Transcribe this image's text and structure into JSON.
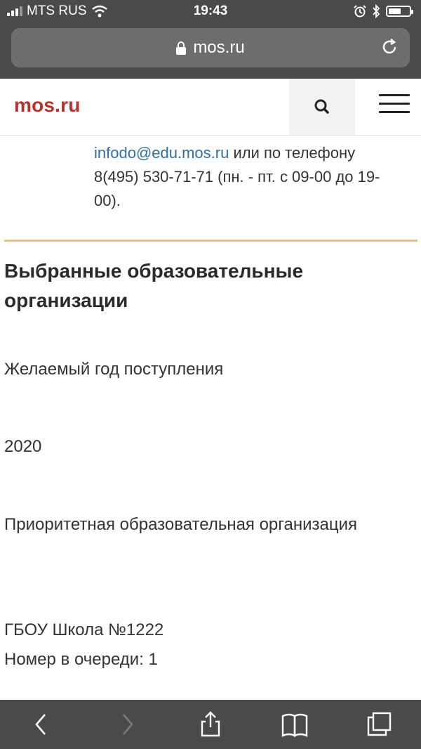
{
  "status_bar": {
    "carrier": "MTS RUS",
    "time": "19:43",
    "battery_level": 0.6
  },
  "browser": {
    "url": "mos.ru"
  },
  "header": {
    "logo": "mos.ru"
  },
  "contact": {
    "email": "infodo@edu.mos.ru",
    "text_after_email": " или по телефону 8(495) 530-71-71 (пн. - пт. с 09-00 до 19-00)."
  },
  "section": {
    "title": "Выбранные образовательные организации"
  },
  "fields": {
    "year_label": "Желаемый год поступления",
    "year_value": "2020",
    "priority_label": "Приоритетная образовательная организация",
    "school_name": "ГБОУ Школа №1222",
    "queue_number": "Номер в очереди: 1"
  },
  "colors": {
    "logo": "#b5332e",
    "link": "#2f6fa7",
    "divider": "#e8c873",
    "chrome": "#4a4a4a"
  },
  "icons": [
    "signal-icon",
    "wifi-icon",
    "alarm-icon",
    "bluetooth-icon",
    "battery-icon",
    "lock-icon",
    "reload-icon",
    "search-icon",
    "hamburger-icon",
    "back-icon",
    "forward-icon",
    "share-icon",
    "bookmarks-icon",
    "tabs-icon"
  ]
}
